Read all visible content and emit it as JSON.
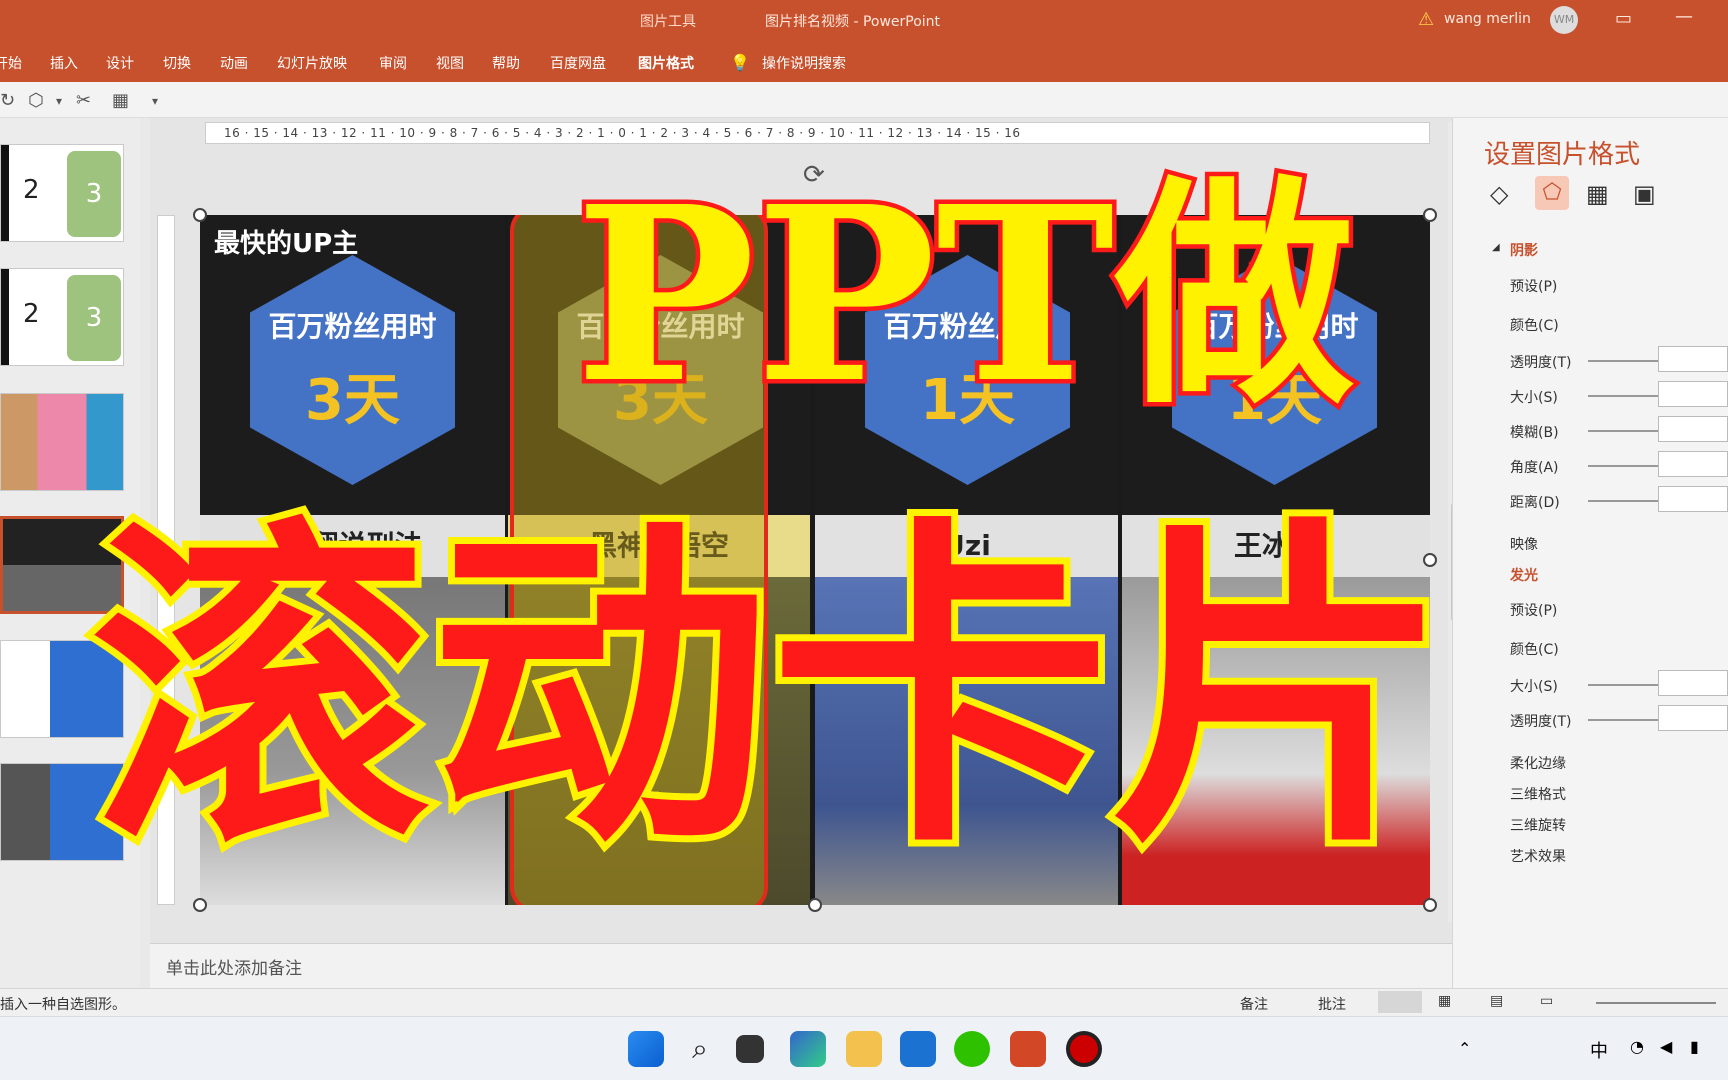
{
  "titlebar": {
    "context_group": "图片工具",
    "doc_title": "图片排名视频  -  PowerPoint",
    "user": "wang merlin",
    "avatar": "WM"
  },
  "ribbon_tabs": [
    "开始",
    "插入",
    "设计",
    "切换",
    "动画",
    "幻灯片放映",
    "审阅",
    "视图",
    "帮助",
    "百度网盘",
    "图片格式"
  ],
  "active_tab": "图片格式",
  "search": "操作说明搜索",
  "ruler_text": "16 · 15 · 14 · 13 · 12 · 11 · 10 · 9 · 8 · 7 · 6 · 5 · 4 · 3 · 2 · 1 · 0 · 1 · 2 · 3 · 4 · 5 · 6 · 7 · 8 · 9 · 10 · 11 · 12 · 13 · 14 · 15 · 16",
  "thumbs": {
    "t1_a": "2",
    "t1_b": "3",
    "t2_a": "2",
    "t2_b": "3"
  },
  "slide": {
    "header": "最快的UP主",
    "cards": [
      {
        "hex_title": "百万粉丝用时",
        "hex_value": "3天",
        "name": "罗翔说刑法"
      },
      {
        "hex_title": "百万粉丝用时",
        "hex_value": "3天",
        "name": "黑神话悟空"
      },
      {
        "hex_title": "百万粉丝用时",
        "hex_value": "1天",
        "name": "Uzi"
      },
      {
        "hex_title": "百万粉丝用时",
        "hex_value": "1天",
        "name": "王冰冰"
      }
    ]
  },
  "overlay": {
    "line1": "PPT做",
    "line2": "滚动卡片"
  },
  "format_pane": {
    "title": "设置图片格式",
    "shadow": "阴影",
    "shadow_items": [
      "预设(P)",
      "颜色(C)",
      "透明度(T)",
      "大小(S)",
      "模糊(B)",
      "角度(A)",
      "距离(D)"
    ],
    "reflection": "映像",
    "glow": "发光",
    "glow_items": [
      "预设(P)",
      "颜色(C)",
      "大小(S)",
      "透明度(T)"
    ],
    "soft_edges": "柔化边缘",
    "format_3d": "三维格式",
    "rotation_3d": "三维旋转",
    "artistic": "艺术效果"
  },
  "notes": "单击此处添加备注",
  "status": {
    "message": "插入一种自选图形。",
    "notes_btn": "备注",
    "comments_btn": "批注"
  },
  "tray": {
    "ime": "中"
  },
  "colors": {
    "accent": "#c8512d",
    "hex_fill": "#4472c4",
    "overlay_yellow": "#fff200",
    "overlay_red": "#ff1a1a"
  }
}
